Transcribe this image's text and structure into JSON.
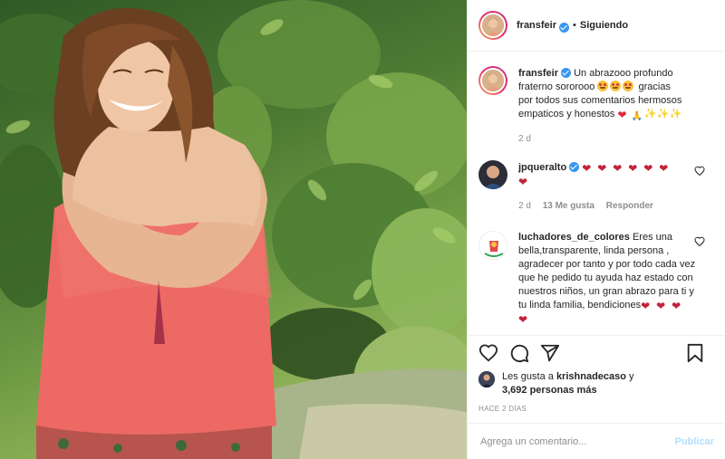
{
  "post": {
    "username": "fransfeir",
    "separator": "•",
    "follow_status": "Siguiendo"
  },
  "caption": {
    "username": "fransfeir",
    "text_line1": "Un abrazooo profundo",
    "text_line2": "fraterno sororooo",
    "text_line2b": "gracias",
    "text_line3": "por todos sus comentarios hermosos",
    "text_line4": "empaticos y honestos",
    "time": "2 d"
  },
  "comments": [
    {
      "username": "jpqueralto",
      "time": "2 d",
      "likes": "13 Me gusta",
      "reply": "Responder"
    },
    {
      "username": "luchadores_de_colores",
      "text": "Eres una bella,transparente, linda persona , agradecer por tanto y por todo cada vez que he pedido tu ayuda haz estado con nuestros niños, un gran abrazo para ti y tu linda familia, bendiciones"
    }
  ],
  "likes_summary": {
    "prefix": "Les gusta a",
    "user": "krishnadecaso",
    "conj": "y",
    "others": "3,692 personas más"
  },
  "date": "HACE 2 DÍAS",
  "add_comment": {
    "placeholder": "Agrega un comentario...",
    "publish": "Publicar"
  },
  "icons": {
    "like": "heart-icon",
    "comment": "comment-icon",
    "share": "share-icon",
    "save": "bookmark-icon",
    "verified": "verified-badge-icon"
  },
  "colors": {
    "verified": "#3897f0",
    "publish_disabled": "#b2dffc",
    "muted": "#8e8e8e",
    "heart_red": "#e0263a"
  }
}
